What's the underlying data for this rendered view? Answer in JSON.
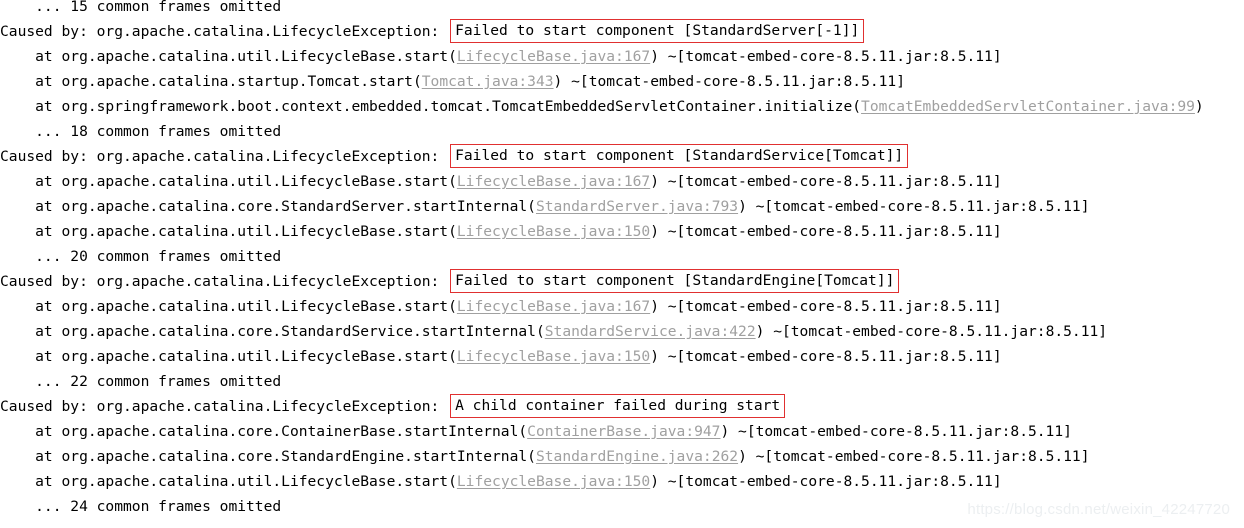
{
  "console": {
    "jar": " ~[tomcat-embed-core-8.5.11.jar:8.5.11]",
    "caused_by_prefix": "Caused by: org.apache.catalina.LifecycleException: ",
    "lines": [
      {
        "id": "line-0-frames-omitted",
        "pre": "    ... 15 common frames omitted",
        "clipped_top": true
      },
      {
        "id": "line-1-caused-by-standardserver",
        "pre": "Caused by: org.apache.catalina.LifecycleException: ",
        "boxed": "Failed to start component [StandardServer[-1]]",
        "post": ""
      },
      {
        "id": "line-2-at-lifecyclebase-167",
        "pre": "    at org.apache.catalina.util.LifecycleBase.start(",
        "link": "LifecycleBase.java:167",
        "post": ") ~[tomcat-embed-core-8.5.11.jar:8.5.11]"
      },
      {
        "id": "line-3-at-tomcat-343",
        "pre": "    at org.apache.catalina.startup.Tomcat.start(",
        "link": "Tomcat.java:343",
        "post": ") ~[tomcat-embed-core-8.5.11.jar:8.5.11]"
      },
      {
        "id": "line-4-at-tomcatembeddedservletcontainer-99",
        "pre": "    at org.springframework.boot.context.embedded.tomcat.TomcatEmbeddedServletContainer.initialize(",
        "link": "TomcatEmbeddedServletContainer.java:99",
        "post": ")"
      },
      {
        "id": "line-5-frames-omitted",
        "pre": "    ... 18 common frames omitted"
      },
      {
        "id": "line-6-caused-by-standardservice",
        "pre": "Caused by: org.apache.catalina.LifecycleException: ",
        "boxed": "Failed to start component [StandardService[Tomcat]]",
        "post": ""
      },
      {
        "id": "line-7-at-lifecyclebase-167",
        "pre": "    at org.apache.catalina.util.LifecycleBase.start(",
        "link": "LifecycleBase.java:167",
        "post": ") ~[tomcat-embed-core-8.5.11.jar:8.5.11]"
      },
      {
        "id": "line-8-at-standardserver-793",
        "pre": "    at org.apache.catalina.core.StandardServer.startInternal(",
        "link": "StandardServer.java:793",
        "post": ") ~[tomcat-embed-core-8.5.11.jar:8.5.11]"
      },
      {
        "id": "line-9-at-lifecyclebase-150",
        "pre": "    at org.apache.catalina.util.LifecycleBase.start(",
        "link": "LifecycleBase.java:150",
        "post": ") ~[tomcat-embed-core-8.5.11.jar:8.5.11]"
      },
      {
        "id": "line-10-frames-omitted",
        "pre": "    ... 20 common frames omitted"
      },
      {
        "id": "line-11-caused-by-standardengine",
        "pre": "Caused by: org.apache.catalina.LifecycleException: ",
        "boxed": "Failed to start component [StandardEngine[Tomcat]]",
        "post": ""
      },
      {
        "id": "line-12-at-lifecyclebase-167",
        "pre": "    at org.apache.catalina.util.LifecycleBase.start(",
        "link": "LifecycleBase.java:167",
        "post": ") ~[tomcat-embed-core-8.5.11.jar:8.5.11]"
      },
      {
        "id": "line-13-at-standardservice-422",
        "pre": "    at org.apache.catalina.core.StandardService.startInternal(",
        "link": "StandardService.java:422",
        "post": ") ~[tomcat-embed-core-8.5.11.jar:8.5.11]"
      },
      {
        "id": "line-14-at-lifecyclebase-150",
        "pre": "    at org.apache.catalina.util.LifecycleBase.start(",
        "link": "LifecycleBase.java:150",
        "post": ") ~[tomcat-embed-core-8.5.11.jar:8.5.11]"
      },
      {
        "id": "line-15-frames-omitted",
        "pre": "    ... 22 common frames omitted"
      },
      {
        "id": "line-16-caused-by-child-container",
        "pre": "Caused by: org.apache.catalina.LifecycleException: ",
        "boxed": "A child container failed during start",
        "post": ""
      },
      {
        "id": "line-17-at-containerbase-947",
        "pre": "    at org.apache.catalina.core.ContainerBase.startInternal(",
        "link": "ContainerBase.java:947",
        "post": ") ~[tomcat-embed-core-8.5.11.jar:8.5.11]"
      },
      {
        "id": "line-18-at-standardengine-262",
        "pre": "    at org.apache.catalina.core.StandardEngine.startInternal(",
        "link": "StandardEngine.java:262",
        "post": ") ~[tomcat-embed-core-8.5.11.jar:8.5.11]"
      },
      {
        "id": "line-19-at-lifecyclebase-150",
        "pre": "    at org.apache.catalina.util.LifecycleBase.start(",
        "link": "LifecycleBase.java:150",
        "post": ") ~[tomcat-embed-core-8.5.11.jar:8.5.11]"
      },
      {
        "id": "line-20-frames-omitted",
        "pre": "    ... 24 common frames omitted"
      }
    ]
  },
  "watermark": {
    "text": "https://blog.csdn.net/weixin_42247720"
  },
  "colors": {
    "background": "#ffffff",
    "text": "#000000",
    "link": "#a0a0a0",
    "annotation_box": "#e03030",
    "watermark": "#eceff1"
  }
}
